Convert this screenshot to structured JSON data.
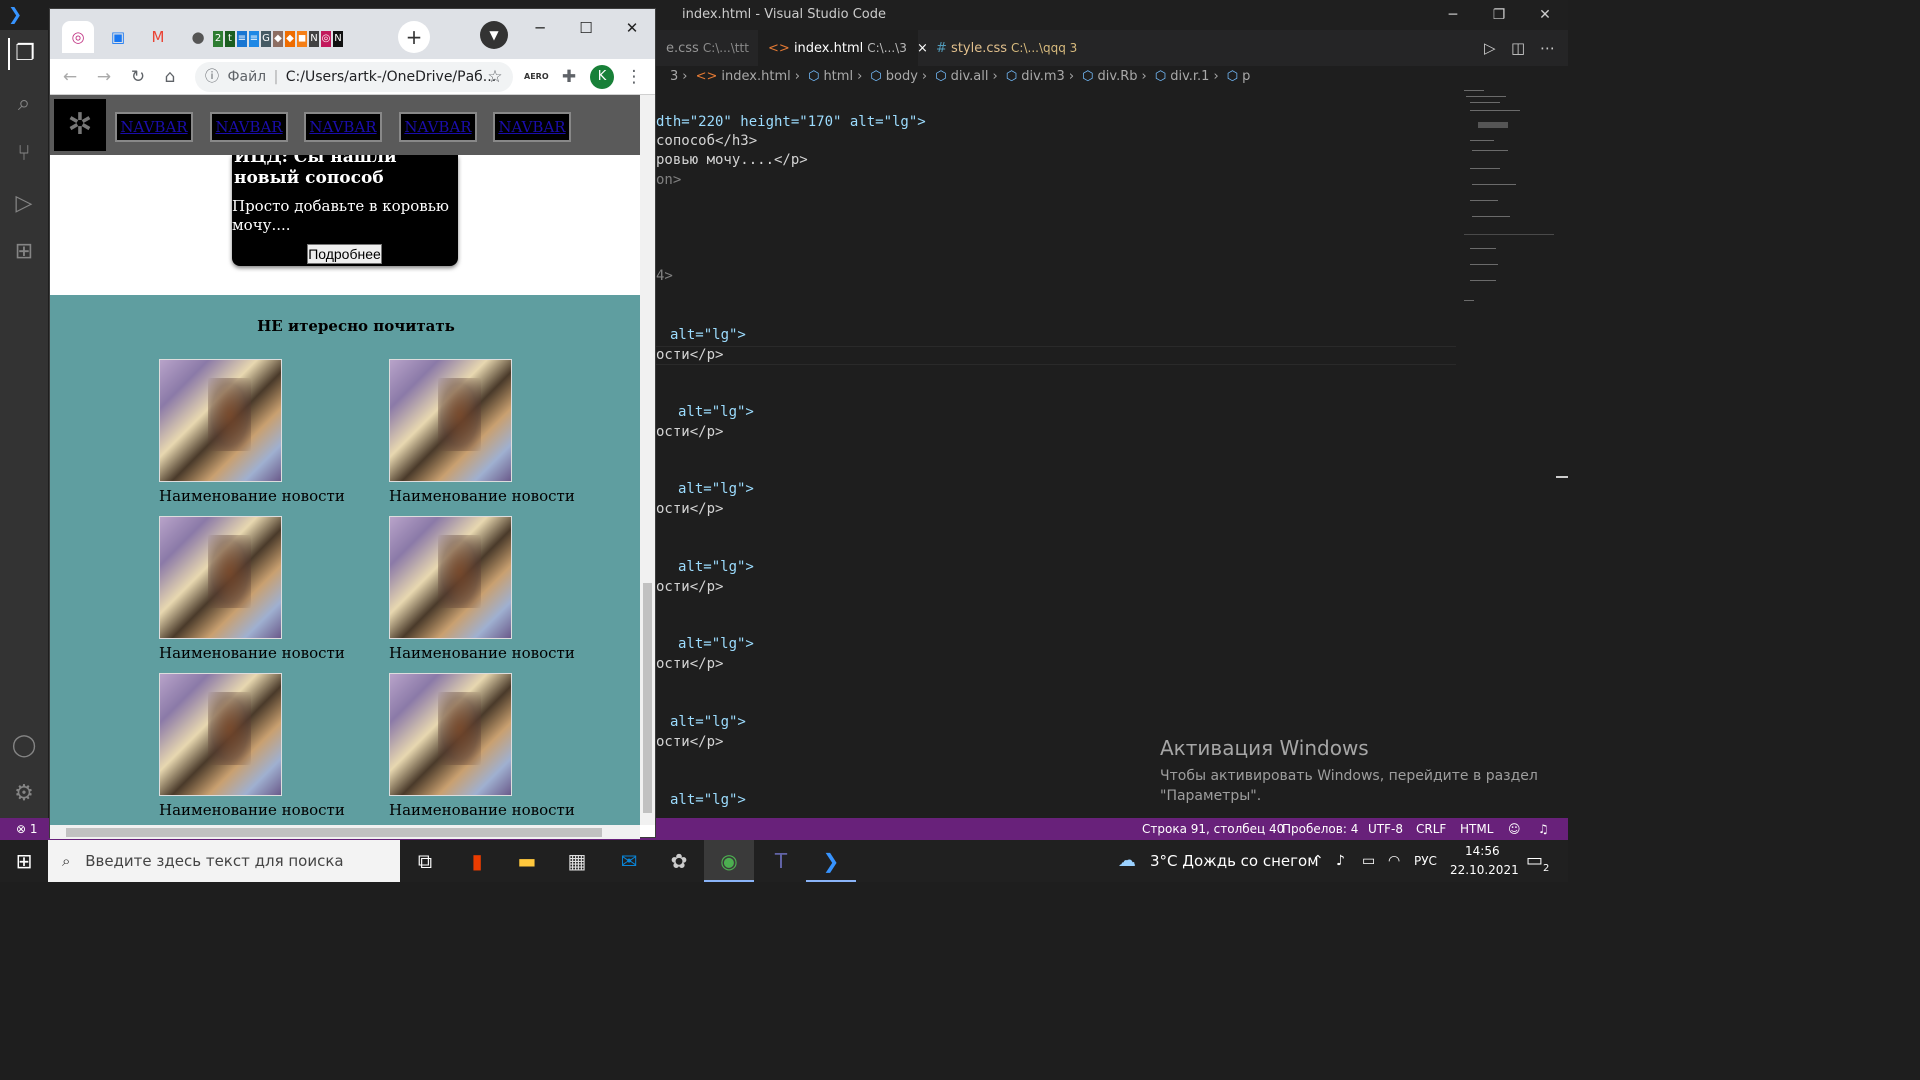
{
  "vscode": {
    "window_title": "index.html - Visual Studio Code",
    "tabs": [
      {
        "label": "e.css",
        "path": "C:\\...\\ttt"
      },
      {
        "label": "index.html",
        "path": "C:\\...\\3",
        "close": "×"
      },
      {
        "label": "style.css",
        "path": "C:\\...\\qqq 3"
      }
    ],
    "breadcrumb": [
      "3",
      "index.html",
      "html",
      "body",
      "div.all",
      "div.m3",
      "div.Rb",
      "div.r.1",
      "p"
    ],
    "code": {
      "l1": "dth=\"220\" height=\"170\" alt=\"lg\">",
      "l2": "сопособ</h3>",
      "l3": "ровью мочу....</p>",
      "l4": "on>",
      "l5": "4>",
      "alt": "alt=\"lg\">",
      "p_close": "ости</p>"
    },
    "activation": {
      "title": "Активация Windows",
      "text": "Чтобы активировать Windows, перейдите в раздел \"Параметры\"."
    },
    "status": {
      "errors": "1",
      "position": "Строка 91, столбец 40",
      "spaces": "Пробелов: 4",
      "encoding": "UTF-8",
      "eol": "CRLF",
      "language": "HTML"
    }
  },
  "chrome": {
    "address_label": "Файл",
    "address": "C:/Users/artk-/OneDrive/Раб...",
    "profile_initial": "K",
    "aero_label": "AERO",
    "page": {
      "nav_links": [
        "NAVBAR",
        "NAVBAR",
        "NAVBAR",
        "NAVBAR",
        "NAVBAR"
      ],
      "promo_heading": "ИЦД: Сы нашли новый сопособ",
      "promo_text": "Просто добавьте в коровью мочу....",
      "promo_button": "Подробнее",
      "section_heading": "НЕ итересно почитать",
      "news_caption": "Наименование новости"
    }
  },
  "taskbar": {
    "search_placeholder": "Введите здесь текст для поиска",
    "weather": "3°C Дождь со снегом",
    "language": "РУС",
    "time": "14:56",
    "date": "22.10.2021",
    "notifications": "2"
  },
  "colors": {
    "vscode_status": "#68217a",
    "teal_section": "#5f9ea0",
    "nav_bg": "#5a5a5a"
  }
}
